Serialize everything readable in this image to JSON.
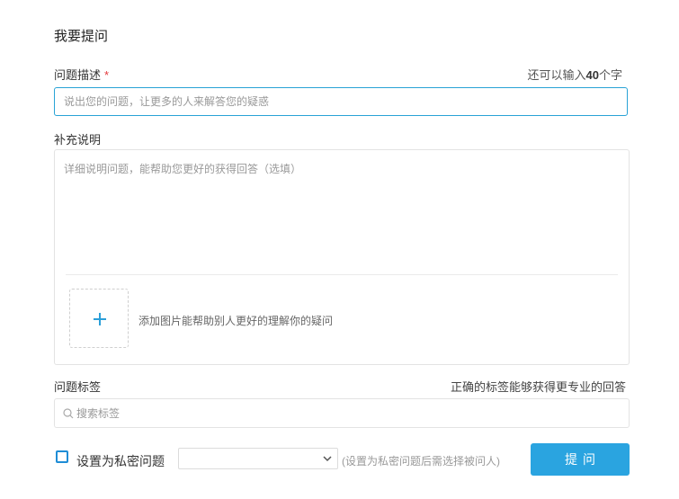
{
  "page": {
    "title": "我要提问"
  },
  "question": {
    "label": "问题描述",
    "required_mark": "*",
    "remaining_prefix": "还可以输入",
    "remaining_count": "40",
    "remaining_suffix": "个字",
    "placeholder": "说出您的问题，让更多的人来解答您的疑惑",
    "value": ""
  },
  "details": {
    "label": "补充说明",
    "placeholder": "详细说明问题，能帮助您更好的获得回答（选填）",
    "upload_icon": "plus-icon",
    "upload_hint": "添加图片能帮助别人更好的理解你的疑问"
  },
  "tags": {
    "label": "问题标签",
    "hint": "正确的标签能够获得更专业的回答",
    "search_icon": "search-icon",
    "placeholder": "搜索标签",
    "value": ""
  },
  "private": {
    "checked": false,
    "label": "设置为私密问题",
    "select_value": "",
    "hint": "(设置为私密问题后需选择被问人)"
  },
  "submit": {
    "label": "提问"
  },
  "colors": {
    "accent": "#2aa4e0",
    "input_focus_border": "#29a3d6",
    "required": "#e4393c"
  }
}
